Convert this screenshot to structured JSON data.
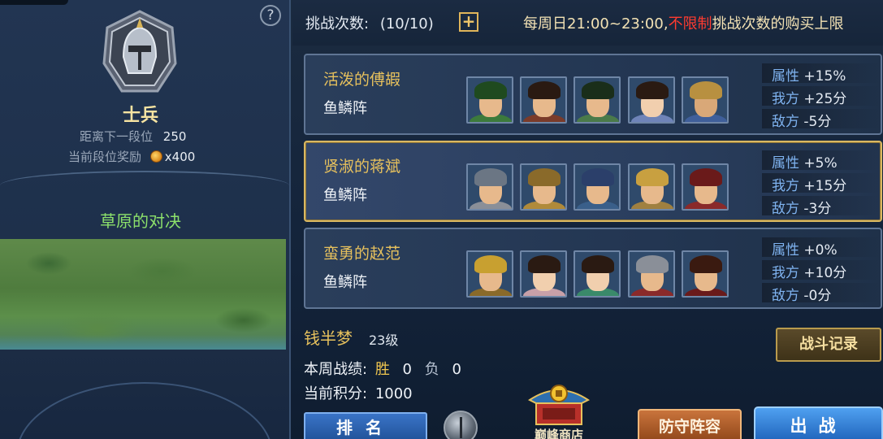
{
  "left_panel": {
    "help_icon_glyph": "?",
    "rank_title": "士兵",
    "next_rank_label": "距离下一段位",
    "next_rank_value": "250",
    "reward_label": "当前段位奖励",
    "reward_value": "x400",
    "map_title": "草原的对决"
  },
  "top_bar": {
    "challenge_label": "挑战次数:",
    "challenge_count": "(10/10)",
    "plus_glyph": "+",
    "notice_prefix": "每周日21:00~23:00,",
    "notice_highlight": "不限制",
    "notice_suffix": "挑战次数的购买上限"
  },
  "opponents": [
    {
      "name": "活泼的傅嘏",
      "formation": "鱼鳞阵",
      "attr_label": "属性",
      "attr_value": "+15%",
      "our_label": "我方",
      "our_value": "+25分",
      "enemy_label": "敌方",
      "enemy_value": "-5分"
    },
    {
      "name": "贤淑的蒋斌",
      "formation": "鱼鳞阵",
      "attr_label": "属性",
      "attr_value": "+5%",
      "our_label": "我方",
      "our_value": "+15分",
      "enemy_label": "敌方",
      "enemy_value": "-3分"
    },
    {
      "name": "蛮勇的赵范",
      "formation": "鱼鳞阵",
      "attr_label": "属性",
      "attr_value": "+0%",
      "our_label": "我方",
      "our_value": "+10分",
      "enemy_label": "敌方",
      "enemy_value": "-0分"
    }
  ],
  "player": {
    "name": "钱半梦",
    "level": "23级",
    "week_label": "本周战绩:",
    "win_label": "胜",
    "win_count": "0",
    "loss_label": "负",
    "loss_count": "0",
    "score_label": "当前积分:",
    "score_value": "1000"
  },
  "buttons": {
    "battle_record": "战斗记录",
    "ranking": "排名",
    "shop": "巅峰商店",
    "defense": "防守阵容",
    "fight": "出战"
  },
  "colors": {
    "gold_text": "#e7c15d",
    "stat_key": "#7fb3f0",
    "highlight_red": "#ff3b30",
    "map_title_green": "#8ce06b"
  }
}
